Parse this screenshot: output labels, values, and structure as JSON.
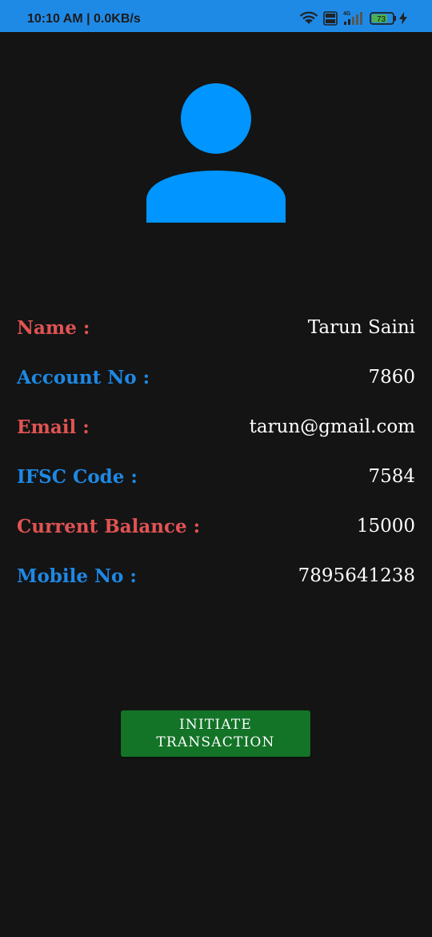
{
  "status_bar": {
    "time": "10:10 AM | 0.0KB/s",
    "network": "4G",
    "volte": "Vo LTE",
    "battery_level": "73",
    "icons": [
      "wifi-icon",
      "volte-icon",
      "signal-icon",
      "battery-icon",
      "charging-icon"
    ]
  },
  "profile": {
    "avatar_icon": "person-icon"
  },
  "details": [
    {
      "label": "Name :",
      "value": "Tarun Saini",
      "label_color": "#e05353"
    },
    {
      "label": "Account No :",
      "value": "7860",
      "label_color": "#1e88e5"
    },
    {
      "label": "Email :",
      "value": "tarun@gmail.com",
      "label_color": "#e05353"
    },
    {
      "label": "IFSC Code :",
      "value": "7584",
      "label_color": "#1e88e5"
    },
    {
      "label": "Current Balance :",
      "value": "15000",
      "label_color": "#e05353"
    },
    {
      "label": "Mobile No :",
      "value": "7895641238",
      "label_color": "#1e88e5"
    }
  ],
  "action": {
    "line1": "INITIATE",
    "line2": "TRANSACTION"
  },
  "colors": {
    "status_bar": "#1f8ae6",
    "background": "#141414",
    "avatar": "#0095ff",
    "button": "#137327"
  }
}
